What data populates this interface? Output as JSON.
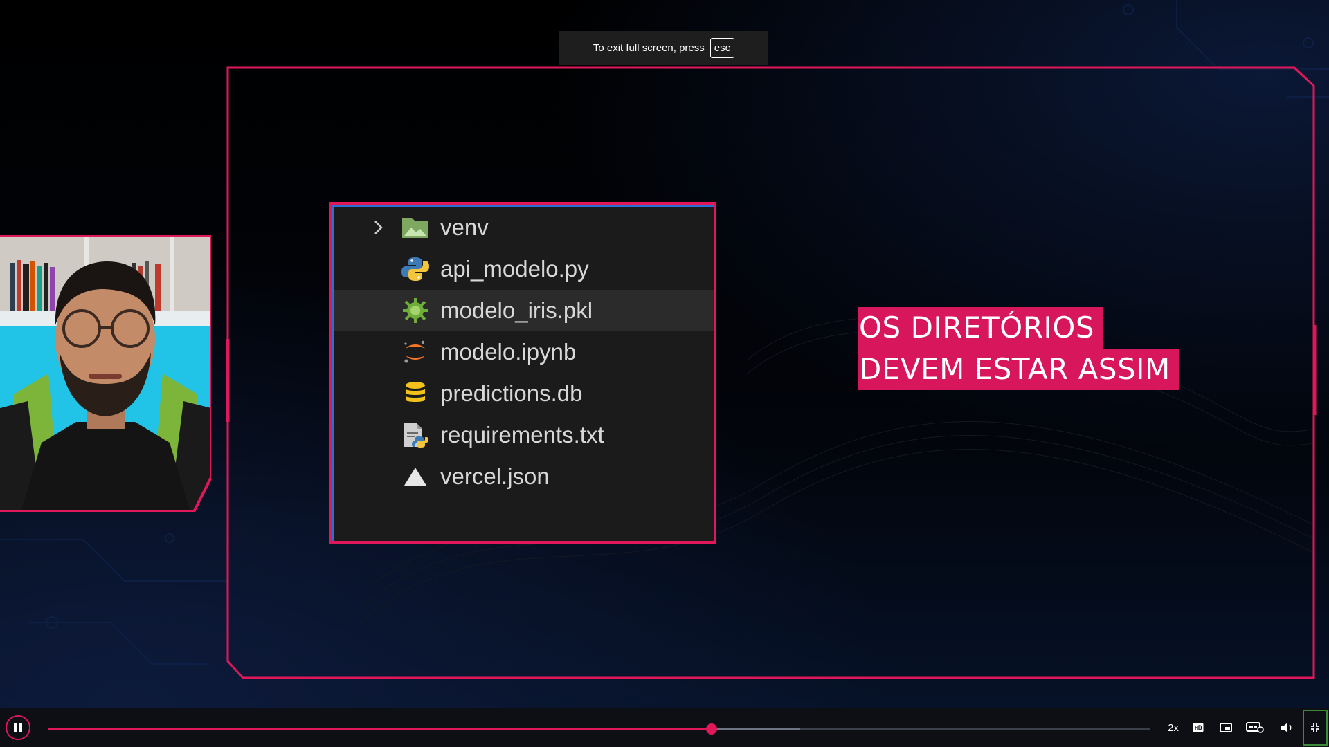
{
  "toast": {
    "message": "To exit full screen, press",
    "key": "esc"
  },
  "explorer": {
    "files": [
      {
        "name": "venv",
        "icon": "folder-icon",
        "expandable": true
      },
      {
        "name": "api_modelo.py",
        "icon": "python-icon"
      },
      {
        "name": "modelo_iris.pkl",
        "icon": "pickle-icon",
        "active": true
      },
      {
        "name": "modelo.ipynb",
        "icon": "jupyter-icon"
      },
      {
        "name": "predictions.db",
        "icon": "database-icon"
      },
      {
        "name": "requirements.txt",
        "icon": "requirements-file-icon"
      },
      {
        "name": "vercel.json",
        "icon": "vercel-triangle-icon"
      }
    ]
  },
  "caption": {
    "line1": "OS DIRETÓRIOS",
    "line2": "DEVEM ESTAR ASSIM"
  },
  "player": {
    "speed_label": "2x",
    "progress_fraction": 0.602,
    "buffered_fraction": 0.682,
    "accent_color": "#e0185a"
  }
}
